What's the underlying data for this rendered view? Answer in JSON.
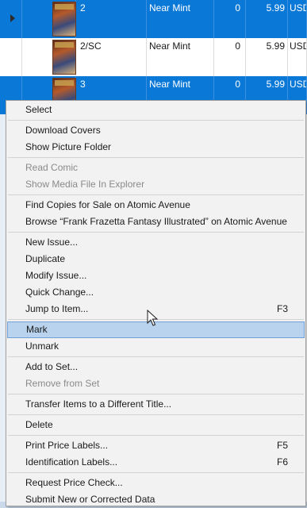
{
  "grid": {
    "rows": [
      {
        "issue": "2",
        "condition": "Near Mint",
        "qty": "0",
        "price": "5.99",
        "currency": "USD",
        "selected": true
      },
      {
        "issue": "2/SC",
        "condition": "Near Mint",
        "qty": "0",
        "price": "5.99",
        "currency": "USD",
        "selected": false
      },
      {
        "issue": "3",
        "condition": "Near Mint",
        "qty": "0",
        "price": "5.99",
        "currency": "USD",
        "selected": true
      }
    ]
  },
  "menu": {
    "select": "Select",
    "download_covers": "Download Covers",
    "show_picture_folder": "Show Picture Folder",
    "read_comic": "Read Comic",
    "show_media_file": "Show Media File In Explorer",
    "find_copies": "Find Copies for Sale on Atomic Avenue",
    "browse_title": "Browse “Frank Frazetta Fantasy Illustrated” on Atomic Avenue",
    "new_issue": "New Issue...",
    "duplicate": "Duplicate",
    "modify_issue": "Modify Issue...",
    "quick_change": "Quick Change...",
    "jump_to_item": "Jump to Item...",
    "jump_to_item_shortcut": "F3",
    "mark": "Mark",
    "unmark": "Unmark",
    "add_to_set": "Add to Set...",
    "remove_from_set": "Remove from Set",
    "transfer_items": "Transfer Items to a Different Title...",
    "delete": "Delete",
    "print_price_labels": "Print Price Labels...",
    "print_price_labels_shortcut": "F5",
    "identification_labels": "Identification Labels...",
    "identification_labels_shortcut": "F6",
    "request_price_check": "Request Price Check...",
    "submit_data": "Submit New or Corrected Data"
  },
  "colors": {
    "selection_blue": "#0a78d7",
    "menu_background": "#f2f2f2",
    "menu_hover": "#b9d3ee",
    "disabled_text": "#8a8a8a"
  }
}
